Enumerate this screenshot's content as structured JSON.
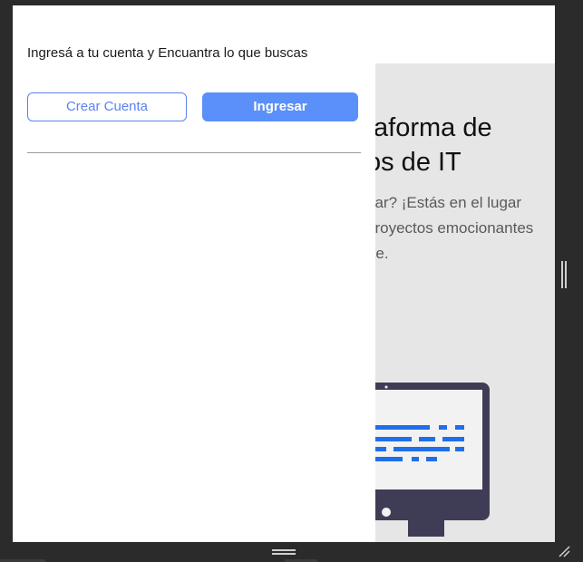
{
  "background_page": {
    "title_line1": "taforma de",
    "title_line2": "os de IT",
    "subtitle_line1": "par? ¡Estás en el lugar",
    "subtitle_line2": "proyectos emocionantes",
    "subtitle_line3": "rte.",
    "illustration_icon": "monitor-code-icon"
  },
  "panel": {
    "title": "Ingresá a tu cuenta y Encuantra lo que buscas",
    "create_account_label": "Crear Cuenta",
    "login_label": "Ingresar"
  },
  "colors": {
    "accent": "#5b8ff9",
    "outline_button": "#5b82f0",
    "background_page": "#e6e6e6",
    "window_chrome": "#2b2b2b",
    "monitor_dark": "#3f3d56",
    "code_blue": "#1f6feb"
  },
  "chrome": {
    "vertical_grip_icon": "grip-vertical-icon",
    "horizontal_grip_icon": "grip-horizontal-icon",
    "resize_icon": "resize-corner-icon"
  }
}
